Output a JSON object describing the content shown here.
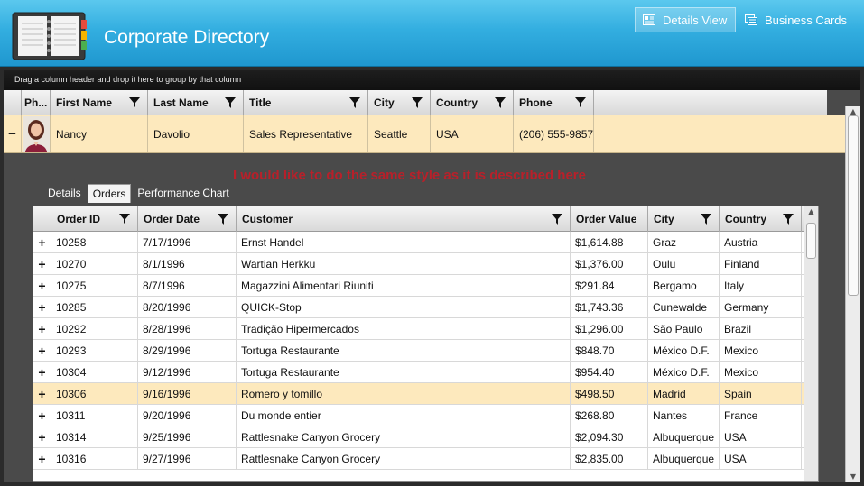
{
  "app": {
    "title": "Corporate Directory",
    "accent": "#2fa8dc",
    "views": [
      {
        "label": "Details View",
        "icon": "details-view-icon",
        "active": true
      },
      {
        "label": "Business Cards",
        "icon": "business-cards-icon",
        "active": false
      }
    ]
  },
  "group_panel": {
    "text": "Drag a column header and drop it here to group by that column"
  },
  "master": {
    "columns": [
      "Ph...",
      "First Name",
      "Last Name",
      "Title",
      "City",
      "Country",
      "Phone"
    ],
    "row": {
      "expander": "−",
      "first_name": "Nancy",
      "last_name": "Davolio",
      "title": "Sales Representative",
      "city": "Seattle",
      "country": "USA",
      "phone": "(206) 555-9857"
    }
  },
  "note": "I would like to do the same style as it is described here",
  "detail_tabs": [
    {
      "label": "Details",
      "active": false
    },
    {
      "label": "Orders",
      "active": true
    },
    {
      "label": "Performance Chart",
      "active": false
    }
  ],
  "orders": {
    "columns": [
      "Order ID",
      "Order Date",
      "Customer",
      "Order Value",
      "City",
      "Country"
    ],
    "rows": [
      {
        "id": "10258",
        "date": "7/17/1996",
        "customer": "Ernst Handel",
        "value": "$1,614.88",
        "city": "Graz",
        "country": "Austria"
      },
      {
        "id": "10270",
        "date": "8/1/1996",
        "customer": "Wartian Herkku",
        "value": "$1,376.00",
        "city": "Oulu",
        "country": "Finland"
      },
      {
        "id": "10275",
        "date": "8/7/1996",
        "customer": "Magazzini Alimentari Riuniti",
        "value": "$291.84",
        "city": "Bergamo",
        "country": "Italy"
      },
      {
        "id": "10285",
        "date": "8/20/1996",
        "customer": "QUICK-Stop",
        "value": "$1,743.36",
        "city": "Cunewalde",
        "country": "Germany"
      },
      {
        "id": "10292",
        "date": "8/28/1996",
        "customer": "Tradição Hipermercados",
        "value": "$1,296.00",
        "city": "São Paulo",
        "country": "Brazil"
      },
      {
        "id": "10293",
        "date": "8/29/1996",
        "customer": "Tortuga Restaurante",
        "value": "$848.70",
        "city": "México D.F.",
        "country": "Mexico"
      },
      {
        "id": "10304",
        "date": "9/12/1996",
        "customer": "Tortuga Restaurante",
        "value": "$954.40",
        "city": "México D.F.",
        "country": "Mexico"
      },
      {
        "id": "10306",
        "date": "9/16/1996",
        "customer": "Romero y tomillo",
        "value": "$498.50",
        "city": "Madrid",
        "country": "Spain",
        "selected": true
      },
      {
        "id": "10311",
        "date": "9/20/1996",
        "customer": "Du monde entier",
        "value": "$268.80",
        "city": "Nantes",
        "country": "France"
      },
      {
        "id": "10314",
        "date": "9/25/1996",
        "customer": "Rattlesnake Canyon Grocery",
        "value": "$2,094.30",
        "city": "Albuquerque",
        "country": "USA"
      },
      {
        "id": "10316",
        "date": "9/27/1996",
        "customer": "Rattlesnake Canyon Grocery",
        "value": "$2,835.00",
        "city": "Albuquerque",
        "country": "USA"
      }
    ]
  }
}
